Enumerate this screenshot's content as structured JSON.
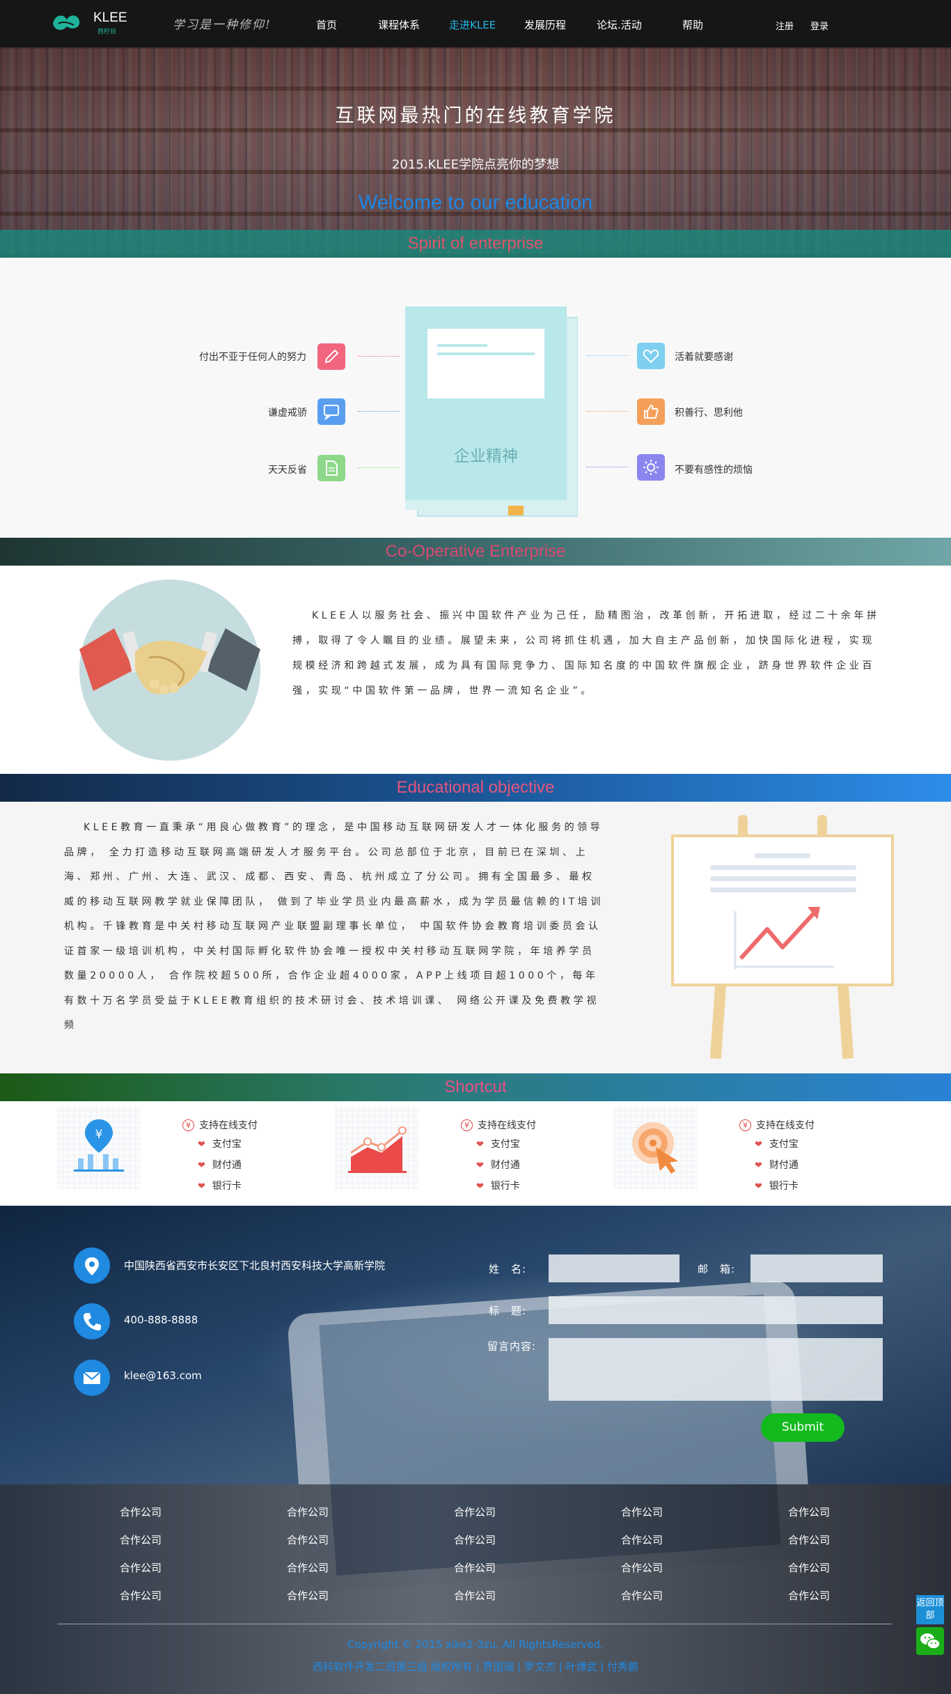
{
  "header": {
    "logo_text": "KLEE",
    "logo_sub": "西柠目",
    "slogan": "学习是一种修仰!",
    "nav": [
      "首页",
      "课程体系",
      "走进KLEE",
      "发展历程",
      "论坛.活动",
      "帮助"
    ],
    "active_nav": "走进KLEE",
    "register": "注册",
    "login": "登录"
  },
  "hero": {
    "title": "互联网最热门的在线教育学院",
    "subtitle": "2015.KLEE学院点亮你的梦想",
    "welcome": "Welcome to our education"
  },
  "spirit": {
    "heading": "Spirit of enterprise",
    "book_label": "企业精神",
    "left": [
      "付出不亚于任何人的努力",
      "谦虚戒骄",
      "天天反省"
    ],
    "right": [
      "活着就要感谢",
      "积善行、思利他",
      "不要有感性的烦恼"
    ]
  },
  "cooperative": {
    "heading": "Co-Operative Enterprise",
    "text": "KLEE人以服务社会、振兴中国软件产业为己任，励精图治，改革创新，开拓进取，经过二十余年拼搏，取得了令人瞩目的业绩。展望未来，公司将抓住机遇，加大自主产品创新，加快国际化进程，实现规模经济和跨越式发展，成为具有国际竞争力、国际知名度的中国软件旗舰企业，跻身世界软件企业百强，实现“中国软件第一品牌，世界一流知名企业”。"
  },
  "education": {
    "heading": "Educational objective",
    "text": "KLEE教育一直秉承“用良心做教育”的理念，是中国移动互联网研发人才一体化服务的领导品牌， 全力打造移动互联网高端研发人才服务平台。公司总部位于北京，目前已在深圳、上海、郑州、广州、大连、武汉、成都、西安、青岛、杭州成立了分公司。拥有全国最多、最权威的移动互联网教学就业保障团队， 做到了毕业学员业内最高薪水，成为学员最信赖的IT培训机构。千锋教育是中关村移动互联网产业联盟副理事长单位， 中国软件协会教育培训委员会认证首家一级培训机构，中关村国际孵化软件协会唯一授权中关村移动互联网学院，年培养学员数量20000人， 合作院校超500所，合作企业超4000家，APP上线项目超1000个，每年有数十万名学员受益于KLEE教育组织的技术研讨会、技术培训课、 网络公开课及免费教学视频"
  },
  "shortcut": {
    "heading": "Shortcut",
    "cards": [
      {
        "icon": "payment-chart-icon",
        "title": "支持在线支付",
        "items": [
          "支付宝",
          "财付通",
          "银行卡"
        ]
      },
      {
        "icon": "growth-chart-icon",
        "title": "支持在线支付",
        "items": [
          "支付宝",
          "财付通",
          "银行卡"
        ]
      },
      {
        "icon": "touch-target-icon",
        "title": "支持在线支付",
        "items": [
          "支付宝",
          "财付通",
          "银行卡"
        ]
      }
    ]
  },
  "contact": {
    "address": "中国陕西省西安市长安区下北良村西安科技大学高新学院",
    "phone": "400-888-8888",
    "email": "klee@163.com",
    "form": {
      "name_label": "姓　名:",
      "email_label": "邮　箱:",
      "subject_label": "标　题:",
      "message_label": "留言内容:",
      "submit": "Submit"
    }
  },
  "footer": {
    "partners": [
      [
        "合作公司",
        "合作公司",
        "合作公司",
        "合作公司",
        "合作公司"
      ],
      [
        "合作公司",
        "合作公司",
        "合作公司",
        "合作公司",
        "合作公司"
      ],
      [
        "合作公司",
        "合作公司",
        "合作公司",
        "合作公司",
        "合作公司"
      ],
      [
        "合作公司",
        "合作公司",
        "合作公司",
        "合作公司",
        "合作公司"
      ]
    ],
    "copyright": "Copyright © 2015 xike2-3zu. All RightsReserved.",
    "credits": "西科软件开发二班第三组 版权所有 | 贾国瑞 | 罗文杰 | 叶博武 | 付秀鹏"
  },
  "side": {
    "back_top": "返回顶部",
    "wechat_icon": "wechat-icon"
  },
  "colors": {
    "nav_active": "#22b7e8",
    "welcome": "#1c86e6",
    "band_title": "#e0536c",
    "submit": "#12ba1e",
    "contact_icon": "#1f8ae0",
    "footer_link": "#1e8ae6"
  }
}
